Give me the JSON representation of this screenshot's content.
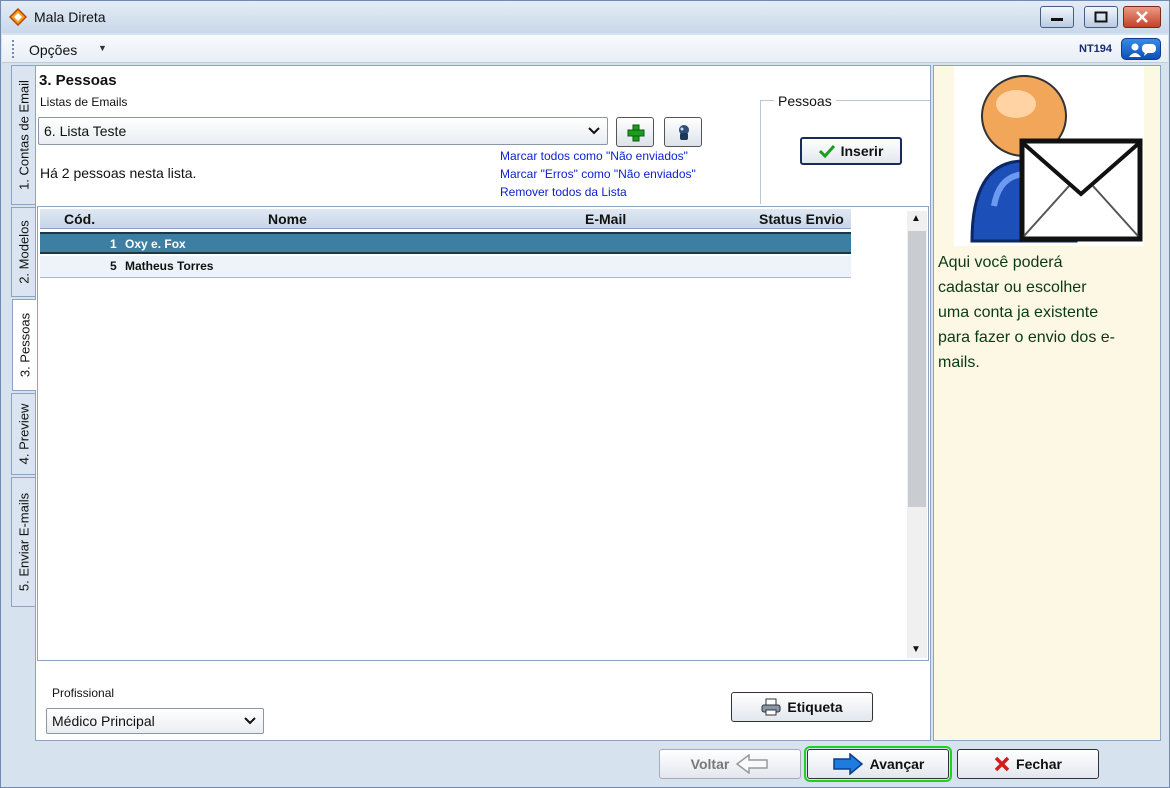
{
  "window": {
    "title": "Mala Direta"
  },
  "menu": {
    "opcoes": "Opções",
    "nt_code": "NT194"
  },
  "tabs": [
    {
      "label": "1. Contas de Email"
    },
    {
      "label": "2. Modelos"
    },
    {
      "label": "3. Pessoas"
    },
    {
      "label": "4. Preview"
    },
    {
      "label": "5. Enviar E-mails"
    }
  ],
  "main": {
    "section_title": "3. Pessoas",
    "listas_label": "Listas de Emails",
    "lista_selected": "6. Lista Teste",
    "info": "Há 2 pessoas nesta lista.",
    "links": {
      "mark_all": "Marcar todos como \"Não enviados\"",
      "mark_errors": "Marcar \"Erros\" como \"Não enviados\"",
      "remove_all": "Remover todos da Lista"
    },
    "pessoas_group": "Pessoas",
    "inserir": "Inserir",
    "columns": {
      "cod": "Cód.",
      "nome": "Nome",
      "email": "E-Mail",
      "status": "Status Envio"
    },
    "rows": [
      {
        "cod": "1",
        "nome": "Oxy e. Fox",
        "email": "",
        "status": ""
      },
      {
        "cod": "5",
        "nome": "Matheus Torres",
        "email": "",
        "status": ""
      }
    ],
    "profissional_label": "Profissional",
    "profissional_selected": "Médico Principal",
    "etiqueta": "Etiqueta"
  },
  "help": {
    "text": "Aqui você poderá cadastar ou escolher uma conta ja existente para fazer o envio dos e-mails."
  },
  "footer": {
    "voltar": "Voltar",
    "avancar": "Avançar",
    "fechar": "Fechar"
  },
  "colors": {
    "accent_blue": "#0a1fcf",
    "selected_row": "#3d7ea3",
    "highlight_green": "#1fd11f"
  }
}
